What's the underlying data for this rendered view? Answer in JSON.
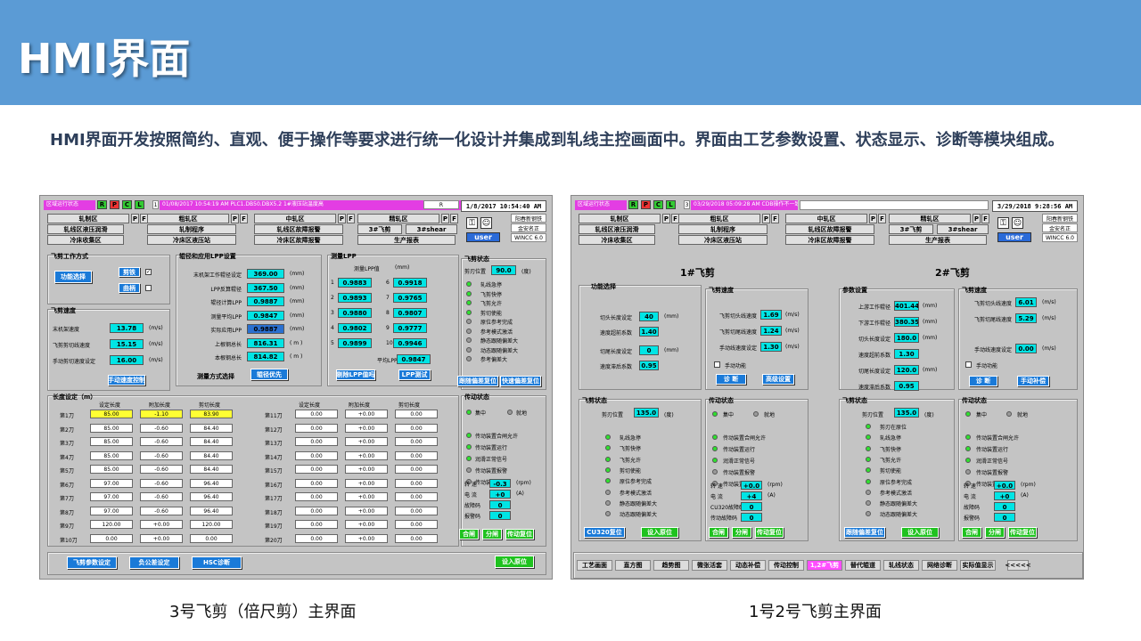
{
  "slide": {
    "title": "HMI界面",
    "intro": "HMI界面开发按照简约、直观、便于操作等要求进行统一化设计并集成到轧线主控画面中。界面由工艺参数设置、状态显示、诊断等模块组成。",
    "caption_left": "3号飞剪（倍尺剪）主界面",
    "caption_right": "1号2号飞剪主界面"
  },
  "colors": {
    "banner": "#5b9bd5",
    "cyan_value": "#00e5e5",
    "status_green": "#2fe02f",
    "blue_button": "#1a7ad8",
    "green_button": "#1fc21f",
    "alarm_pink": "#e33de3"
  },
  "left": {
    "status_tag": "区域运行状态",
    "rpcl": [
      "R",
      "P",
      "C",
      "L"
    ],
    "alarm": {
      "idx": "1",
      "date": "01/08/2017",
      "time": "10:54:19 AM",
      "src": "PLC1.DB50.DBX5.2",
      "msg": "1#液压站温度高",
      "flag": "R"
    },
    "clock": "1/8/2017 10:54:40 AM",
    "user": "user",
    "info": [
      "阳春新钢铁",
      "金安名正",
      "WINCC 6.0"
    ],
    "nav": {
      "r1": [
        "轧制区",
        "粗轧区",
        "中轧区",
        "精轧区"
      ],
      "r2": [
        "轧线区液压润滑",
        "轧制程序",
        "轧线区故障报警",
        "3#飞剪",
        "3#shear"
      ],
      "r3": [
        "冷床收集区",
        "冷床区液压站",
        "冷床区故障报警",
        "生产报表"
      ]
    },
    "mode": {
      "title": "飞剪工作方式",
      "func": "功能选择",
      "b1": "剪铁",
      "b2": "曲柄"
    },
    "speed": {
      "title": "飞剪速度",
      "rows": [
        {
          "label": "末机架速度",
          "value": "13.78",
          "unit": "(m/s)"
        },
        {
          "label": "飞剪剪切线速度",
          "value": "15.15",
          "unit": "(m/s)"
        },
        {
          "label": "手动剪切速度设定",
          "value": "16.00",
          "unit": "(m/s)"
        }
      ],
      "btn": "手动速度控制"
    },
    "lpp": {
      "title": "辊径和应用LPP设置",
      "unit": "(mm)",
      "rows": [
        {
          "label": "末机架工作辊径设定",
          "value": "369.00"
        },
        {
          "label": "LPP反算辊径",
          "value": "367.50"
        },
        {
          "label": "辊径计算LPP",
          "value": "0.9887"
        },
        {
          "label": "测量平均LPP",
          "value": "0.9847"
        },
        {
          "label": "实际应用LPP",
          "value": "0.9887"
        },
        {
          "label": "上根钢总长",
          "value": "816.31"
        },
        {
          "label": "本根钢总长",
          "value": "814.82"
        }
      ],
      "mode_label": "测量方式选择",
      "mode_btn": "辊径优先"
    },
    "mlpp": {
      "title": "测量LPP",
      "header": "测量LPP值",
      "hunit": "(mm)",
      "items": [
        {
          "n": "1",
          "v": "0.9883"
        },
        {
          "n": "2",
          "v": "0.9893"
        },
        {
          "n": "3",
          "v": "0.9880"
        },
        {
          "n": "4",
          "v": "0.9802"
        },
        {
          "n": "5",
          "v": "0.9899"
        },
        {
          "n": "6",
          "v": "0.9918"
        },
        {
          "n": "7",
          "v": "0.9765"
        },
        {
          "n": "8",
          "v": "0.9807"
        },
        {
          "n": "9",
          "v": "0.9777"
        },
        {
          "n": "10",
          "v": "0.9946"
        }
      ],
      "avg_label": "平均LPP值",
      "avg": "0.9847",
      "b1": "剔除LPP值吗",
      "b2": "LPP测试"
    },
    "shear": {
      "title": "飞剪状态",
      "pos_label": "剪刃位置",
      "pos": "90.0",
      "pos_unit": "(度)",
      "items": [
        "轧线急停",
        "飞剪快停",
        "飞剪允许",
        "剪切使能",
        "原位参考完成",
        "参考模式激活",
        "静态跟随偏差大",
        "动态跟随偏差大",
        "参考偏差大"
      ],
      "b1": "跟随偏差复位",
      "b2": "快速偏差复位"
    },
    "len": {
      "title": "长度设定（m）",
      "h": [
        "设定长度",
        "附加长度",
        "剪切长度"
      ],
      "rows1": [
        [
          "第1刀",
          "85.00",
          "-1.10",
          "83.90"
        ],
        [
          "第2刀",
          "85.00",
          "-0.60",
          "84.40"
        ],
        [
          "第3刀",
          "85.00",
          "-0.60",
          "84.40"
        ],
        [
          "第4刀",
          "85.00",
          "-0.60",
          "84.40"
        ],
        [
          "第5刀",
          "85.00",
          "-0.60",
          "84.40"
        ],
        [
          "第6刀",
          "97.00",
          "-0.60",
          "96.40"
        ],
        [
          "第7刀",
          "97.00",
          "-0.60",
          "96.40"
        ],
        [
          "第8刀",
          "97.00",
          "-0.60",
          "96.40"
        ],
        [
          "第9刀",
          "120.00",
          "+0.00",
          "120.00"
        ],
        [
          "第10刀",
          "0.00",
          "+0.00",
          "0.00"
        ]
      ],
      "rows2": [
        [
          "第11刀",
          "0.00",
          "+0.00",
          "0.00"
        ],
        [
          "第12刀",
          "0.00",
          "+0.00",
          "0.00"
        ],
        [
          "第13刀",
          "0.00",
          "+0.00",
          "0.00"
        ],
        [
          "第14刀",
          "0.00",
          "+0.00",
          "0.00"
        ],
        [
          "第15刀",
          "0.00",
          "+0.00",
          "0.00"
        ],
        [
          "第16刀",
          "0.00",
          "+0.00",
          "0.00"
        ],
        [
          "第17刀",
          "0.00",
          "+0.00",
          "0.00"
        ],
        [
          "第18刀",
          "0.00",
          "+0.00",
          "0.00"
        ],
        [
          "第19刀",
          "0.00",
          "+0.00",
          "0.00"
        ],
        [
          "第20刀",
          "0.00",
          "+0.00",
          "0.00"
        ]
      ]
    },
    "drive": {
      "title": "传动状态",
      "items": [
        "集中",
        "就地",
        "传动装置合闸允许",
        "传动装置运行",
        "润滑正常信号",
        "传动装置报警",
        "传动装置故障"
      ],
      "rows": [
        {
          "l": "转  速",
          "v": "-0.3",
          "u": "(rpm)"
        },
        {
          "l": "电  流",
          "v": "+0",
          "u": "(A)"
        },
        {
          "l": "故障码",
          "v": "0",
          "u": ""
        },
        {
          "l": "报警码",
          "v": "0",
          "u": ""
        }
      ],
      "b": [
        "合闸",
        "分闸",
        "传动复位"
      ]
    },
    "bottom": [
      "飞剪参数设定",
      "负公差设定",
      "HSC诊断"
    ],
    "save": "设入原位"
  },
  "right": {
    "status_tag": "区域运行状态",
    "rpcl": [
      "R",
      "P",
      "C",
      "L"
    ],
    "alarm": {
      "idx": "3",
      "date": "03/29/2018",
      "time": "05:09:28 AM",
      "msg": "CDB操作不一致"
    },
    "clock": "3/29/2018 9:28:56 AM",
    "user": "user",
    "info": [
      "阳春新钢铁",
      "金安名正",
      "WINCC 6.0"
    ],
    "nav": {
      "r1": [
        "轧制区",
        "粗轧区",
        "中轧区",
        "精轧区"
      ],
      "r2": [
        "轧线区液压润滑",
        "轧制程序",
        "轧线区故障报警",
        "3#飞剪",
        "3#shear"
      ],
      "r3": [
        "冷床收集区",
        "冷床区液压站",
        "冷床区故障报警",
        "生产报表"
      ]
    },
    "h1": "1#飞剪",
    "h2": "2#飞剪",
    "p1": {
      "title": "功能选择",
      "rows": [
        {
          "l": "切头长度设定",
          "v": "40",
          "u": "(mm)"
        },
        {
          "l": "速度超前系数",
          "v": "1.40",
          "u": ""
        },
        {
          "l": "切尾长度设定",
          "v": "0",
          "u": "(mm)"
        },
        {
          "l": "速度滞后系数",
          "v": "0.95",
          "u": ""
        }
      ]
    },
    "sp1": {
      "title": "飞剪速度",
      "rows": [
        {
          "l": "飞剪切头线速度",
          "v": "1.69",
          "u": "(m/s)"
        },
        {
          "l": "飞剪切尾线速度",
          "v": "1.24",
          "u": "(m/s)"
        },
        {
          "l": "手动线速度设定",
          "v": "1.30",
          "u": "(m/s)"
        }
      ],
      "chk": "手动功能",
      "b1": "诊 断",
      "b2": "高级设置"
    },
    "p2": {
      "title": "参数设置",
      "rows": [
        {
          "l": "上游工作辊径",
          "v": "401.44",
          "u": "(mm)"
        },
        {
          "l": "下游工作辊径",
          "v": "380.35",
          "u": "(mm)"
        },
        {
          "l": "切头长度设定",
          "v": "180.0",
          "u": "(mm)"
        },
        {
          "l": "速度超前系数",
          "v": "1.30",
          "u": ""
        },
        {
          "l": "切尾长度设定",
          "v": "120.0",
          "u": "(mm)"
        },
        {
          "l": "速度滞后系数",
          "v": "0.95",
          "u": ""
        }
      ]
    },
    "sp2": {
      "title": "飞剪速度",
      "rows": [
        {
          "l": "飞剪切头线速度",
          "v": "6.01",
          "u": "(m/s)"
        },
        {
          "l": "飞剪切尾线速度",
          "v": "5.29",
          "u": "(m/s)"
        },
        {
          "l": "手动线速度设定",
          "v": "0.00",
          "u": "(m/s)"
        }
      ],
      "chk": "手动功能",
      "b1": "诊 断",
      "b2": "手动补偿"
    },
    "st1": {
      "title": "飞剪状态",
      "pos_label": "剪刃位置",
      "pos": "135.0",
      "pos_unit": "(度)",
      "items": [
        "轧线急停",
        "飞剪快停",
        "飞剪允许",
        "剪切使能",
        "原位参考完成",
        "参考模式激活",
        "静态跟随偏差大",
        "动态跟随偏差大"
      ],
      "b1": "CU320复位",
      "b2": "设入原位"
    },
    "dr1": {
      "title": "传动状态",
      "items": [
        "集中",
        "就地",
        "传动装置合闸允许",
        "传动装置运行",
        "润滑正常信号",
        "传动装置报警",
        "传动装置故障"
      ],
      "rows": [
        {
          "l": "转  速",
          "v": "+0.0",
          "u": "(rpm)"
        },
        {
          "l": "电  流",
          "v": "+4",
          "u": "(A)"
        },
        {
          "l": "CU320故障码",
          "v": "0",
          "u": ""
        },
        {
          "l": "传动故障码",
          "v": "0",
          "u": ""
        }
      ],
      "b": [
        "合闸",
        "分闸",
        "传动复位"
      ]
    },
    "st2": {
      "title": "飞剪状态",
      "pos_label": "剪刃位置",
      "pos": "135.0",
      "pos_unit": "(度)",
      "items": [
        "剪刃在原位",
        "轧线急停",
        "飞剪快停",
        "飞剪允许",
        "剪切使能",
        "原位参考完成",
        "参考模式激活",
        "静态跟随偏差大",
        "动态跟随偏差大"
      ],
      "b1": "跟随偏差复位",
      "b2": "设入原位"
    },
    "dr2": {
      "title": "传动状态",
      "items": [
        "集中",
        "就地",
        "传动装置合闸允许",
        "传动装置运行",
        "润滑正常信号",
        "传动装置报警",
        "传动装置故障"
      ],
      "rows": [
        {
          "l": "转  速",
          "v": "+0.0",
          "u": "(rpm)"
        },
        {
          "l": "电  流",
          "v": "+0",
          "u": "(A)"
        },
        {
          "l": "故障码",
          "v": "0",
          "u": ""
        },
        {
          "l": "报警码",
          "v": "0",
          "u": ""
        }
      ],
      "b": [
        "合闸",
        "分闸",
        "传动复位"
      ]
    },
    "navbar": [
      "工艺画面",
      "直方图",
      "趋势图",
      "微张活套",
      "动态补偿",
      "传动控制",
      "1,2#飞剪",
      "替代辊道",
      "轧线状态",
      "网络诊断",
      "实际值显示",
      "<<<<<"
    ]
  }
}
